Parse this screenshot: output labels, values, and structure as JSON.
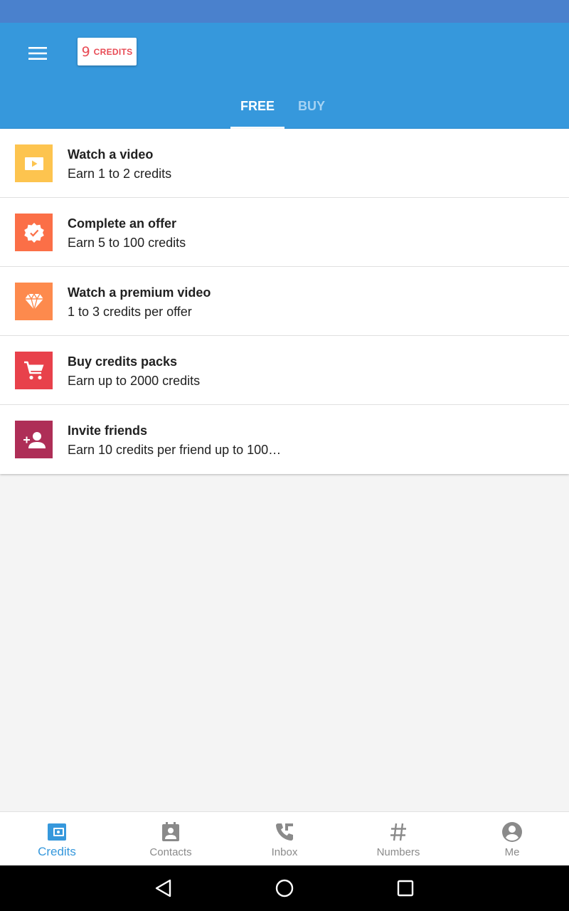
{
  "header": {
    "credits_count": "9",
    "credits_label": "CREDITS",
    "tabs": [
      {
        "label": "FREE",
        "active": true
      },
      {
        "label": "BUY",
        "active": false
      }
    ]
  },
  "earn_options": [
    {
      "title": "Watch a video",
      "subtitle": "Earn 1 to 2 credits",
      "icon": "play-icon",
      "color": "#fdc44f"
    },
    {
      "title": "Complete an offer",
      "subtitle": "Earn 5 to 100 credits",
      "icon": "verified-badge-icon",
      "color": "#fb6f47"
    },
    {
      "title": "Watch a premium video",
      "subtitle": "1 to 3 credits per offer",
      "icon": "diamond-icon",
      "color": "#fd8a4d"
    },
    {
      "title": "Buy credits packs",
      "subtitle": "Earn up to 2000 credits",
      "icon": "cart-icon",
      "color": "#e8414b"
    },
    {
      "title": "Invite friends",
      "subtitle": "Earn 10 credits per friend up to 100…",
      "icon": "add-person-icon",
      "color": "#ae2e57"
    }
  ],
  "bottom_nav": {
    "items": [
      {
        "label": "Credits",
        "icon": "wallet-icon",
        "active": true
      },
      {
        "label": "Contacts",
        "icon": "contacts-icon",
        "active": false
      },
      {
        "label": "Inbox",
        "icon": "phone-icon",
        "active": false
      },
      {
        "label": "Numbers",
        "icon": "hash-icon",
        "active": false
      },
      {
        "label": "Me",
        "icon": "account-icon",
        "active": false
      }
    ]
  },
  "colors": {
    "status_bar": "#4a81cd",
    "primary": "#3698dc",
    "accent_red": "#e84b55",
    "inactive": "#8a8a8a"
  }
}
